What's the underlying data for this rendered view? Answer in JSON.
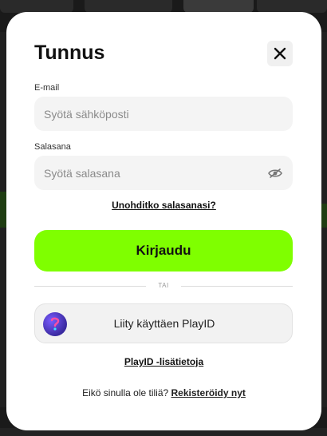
{
  "modal": {
    "title": "Tunnus",
    "close_icon": "close-icon"
  },
  "email": {
    "label": "E-mail",
    "value": "",
    "placeholder": "Syötä sähköposti"
  },
  "password": {
    "label": "Salasana",
    "value": "",
    "placeholder": "Syötä salasana",
    "toggle_icon": "eye-slash-icon"
  },
  "forgot_password": "Unohditko salasanasi?",
  "login_button": "Kirjaudu",
  "divider_text": "TAI",
  "playid": {
    "button_label": "Liity käyttäen PlayID",
    "logo_icon": "playid-logo-icon",
    "info_link": "PlayID -lisätietoja"
  },
  "register": {
    "prompt": "Eikö sinulla ole tiliä?",
    "link": "Rekisteröidy nyt"
  },
  "colors": {
    "primary": "#7fff00",
    "modal_bg": "#ffffff",
    "input_bg": "#f4f4f4",
    "overlay": "#1a1a1a"
  }
}
